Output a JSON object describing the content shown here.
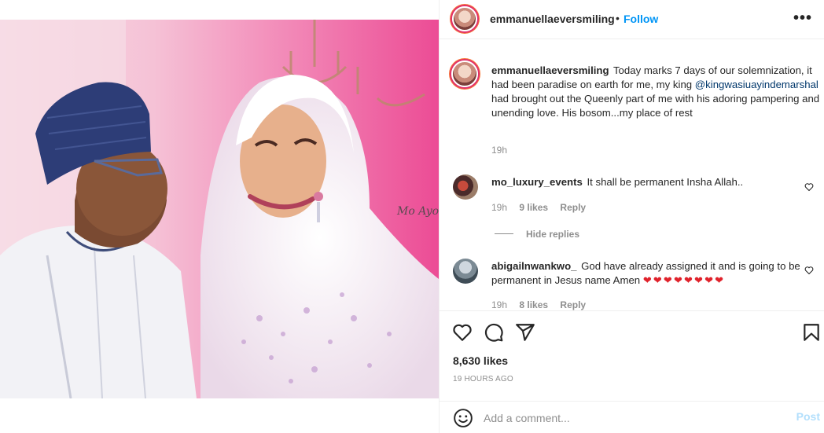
{
  "post": {
    "username": "emmanuellaeversmiling",
    "separator": "•",
    "follow_label": "Follow",
    "more_label": "•••"
  },
  "caption": {
    "username": "emmanuellaeversmiling",
    "text_before": "Today marks 7 days of our solemnization, it had been paradise on earth for me, my king",
    "mention": "@kingwasiuayindemarshal",
    "text_after": "had brought out the Queenly part of me with his adoring pampering and unending love. His bosom...my place of rest",
    "time": "19h"
  },
  "comments": [
    {
      "username": "mo_luxury_events",
      "text": "It shall be permanent Insha Allah..",
      "time": "19h",
      "likes": "9 likes",
      "reply_label": "Reply",
      "hide_replies_label": "Hide replies"
    },
    {
      "username": "abigailnwankwo_",
      "text": "God have already assigned it and is going to be permanent in Jesus name Amen",
      "hearts": "❤❤❤❤❤❤❤❤",
      "time": "19h",
      "likes": "8 likes",
      "reply_label": "Reply"
    }
  ],
  "actions": {
    "icons": [
      "heart-icon",
      "comment-icon",
      "share-icon",
      "bookmark-icon"
    ],
    "likes_count": "8,630 likes",
    "timestamp": "19 HOURS AGO"
  },
  "add_comment": {
    "placeholder": "Add a comment...",
    "post_label": "Post"
  },
  "photo": {
    "watermark": "Mo Ayo"
  },
  "colors": {
    "accent": "#0095f6",
    "post_disabled": "#b2dffc",
    "muted": "#8e8e8e",
    "text": "#262626"
  }
}
